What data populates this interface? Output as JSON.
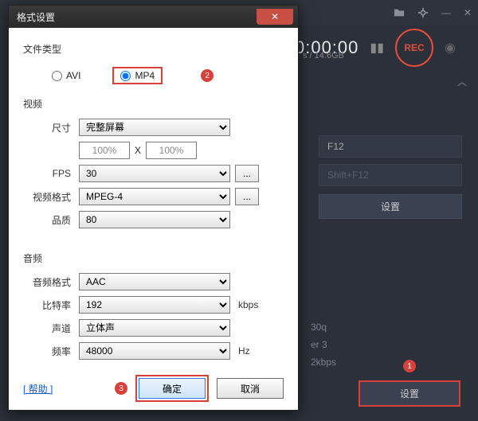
{
  "app": {
    "timer": "0:00:00",
    "storage_suffix": "s / 14.6GB",
    "rec_label": "REC",
    "hotkey1": "F12",
    "hotkey2": "Shift+F12",
    "settings_label": "设置",
    "info_line1": "30q",
    "info_line2": "er 3",
    "info_line3": "2kbps"
  },
  "badges": {
    "b1": "1",
    "b2": "2",
    "b3": "3"
  },
  "dialog": {
    "title": "格式设置",
    "file_type_label": "文件类型",
    "avi_label": "AVI",
    "mp4_label": "MP4",
    "video_section": "视频",
    "size_label": "尺寸",
    "size_value": "完整屏幕",
    "pct1": "100%",
    "x_sep": "X",
    "pct2": "100%",
    "fps_label": "FPS",
    "fps_value": "30",
    "vcodec_label": "视频格式",
    "vcodec_value": "MPEG-4",
    "quality_label": "品质",
    "quality_value": "80",
    "audio_section": "音频",
    "acodec_label": "音频格式",
    "acodec_value": "AAC",
    "bitrate_label": "比特率",
    "bitrate_value": "192",
    "bitrate_unit": "kbps",
    "channel_label": "声道",
    "channel_value": "立体声",
    "freq_label": "频率",
    "freq_value": "48000",
    "freq_unit": "Hz",
    "help_label": "[ 帮助 ]",
    "ok_label": "确定",
    "cancel_label": "取消",
    "dots": "..."
  }
}
